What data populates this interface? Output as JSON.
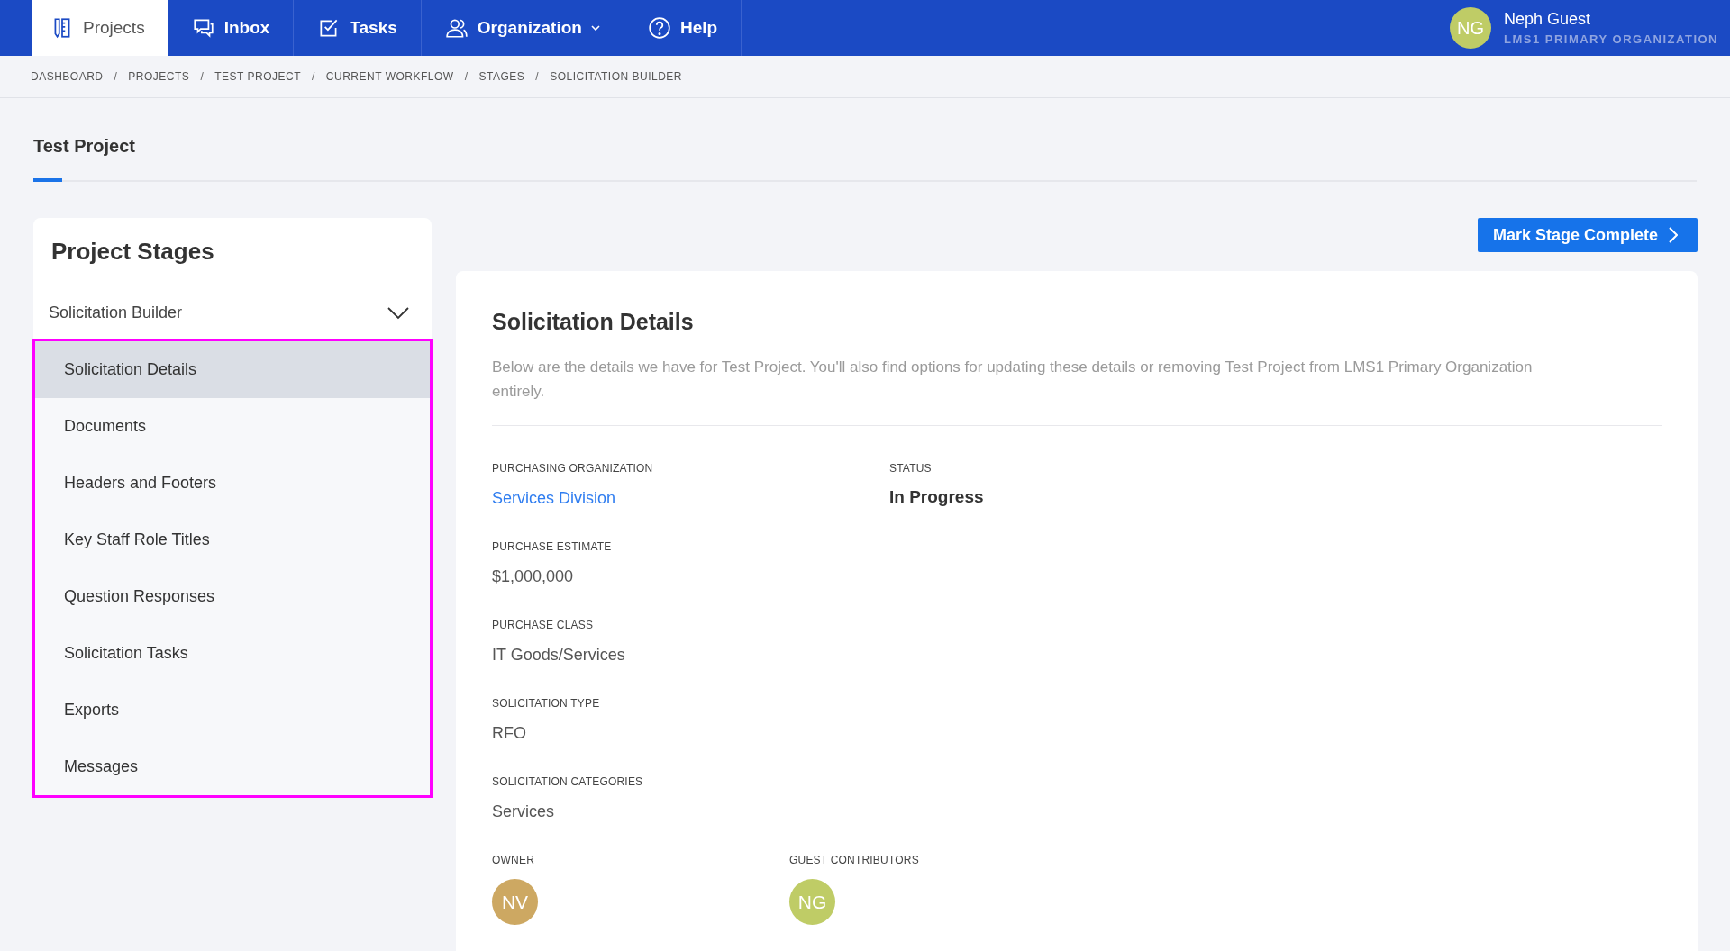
{
  "nav": {
    "tabs": [
      {
        "label": "Projects",
        "selected": true,
        "dropdown": false
      },
      {
        "label": "Inbox",
        "selected": false,
        "dropdown": false
      },
      {
        "label": "Tasks",
        "selected": false,
        "dropdown": false
      },
      {
        "label": "Organization",
        "selected": false,
        "dropdown": true
      },
      {
        "label": "Help",
        "selected": false,
        "dropdown": false
      }
    ],
    "user": {
      "initials": "NG",
      "name": "Neph Guest",
      "organization": "LMS1 PRIMARY ORGANIZATION"
    }
  },
  "breadcrumb": [
    {
      "label": "DASHBOARD"
    },
    {
      "separator": "/",
      "label": "PROJECTS"
    },
    {
      "separator": "/",
      "label": "TEST PROJECT"
    },
    {
      "separator": "/",
      "label": "CURRENT WORKFLOW"
    },
    {
      "separator": "/",
      "label": "STAGES"
    },
    {
      "separator": "/",
      "label": "SOLICITATION BUILDER"
    }
  ],
  "page_tab": {
    "label": "Test Project",
    "selected": true
  },
  "stages": {
    "title": "Project Stages",
    "group": {
      "label": "Solicitation Builder",
      "expanded": true
    },
    "items": [
      {
        "label": "Solicitation Details",
        "selected": true
      },
      {
        "label": "Documents",
        "selected": false
      },
      {
        "label": "Headers and Footers",
        "selected": false
      },
      {
        "label": "Key Staff Role Titles",
        "selected": false
      },
      {
        "label": "Question Responses",
        "selected": false
      },
      {
        "label": "Solicitation Tasks",
        "selected": false
      },
      {
        "label": "Exports",
        "selected": false
      },
      {
        "label": "Messages",
        "selected": false
      }
    ]
  },
  "action_button": "Mark Stage Complete",
  "details": {
    "title": "Solicitation Details",
    "description": "Below are the details we have for Test Project. You'll also find options for updating these details or removing Test Project from LMS1 Primary Organization entirely.",
    "rows": [
      [
        {
          "label": "PURCHASING ORGANIZATION",
          "value": "Services Division",
          "kind": "link"
        },
        {
          "label": "STATUS",
          "value": "In Progress",
          "kind": "strong"
        }
      ],
      [
        {
          "label": "PURCHASE ESTIMATE",
          "value": "$1,000,000",
          "kind": "text"
        }
      ],
      [
        {
          "label": "PURCHASE CLASS",
          "value": "IT Goods/Services",
          "kind": "text"
        }
      ],
      [
        {
          "label": "SOLICITATION TYPE",
          "value": "RFO",
          "kind": "text"
        }
      ],
      [
        {
          "label": "SOLICITATION CATEGORIES",
          "value": "Services",
          "kind": "text"
        }
      ]
    ],
    "people": [
      {
        "label": "OWNER",
        "initials": "NV",
        "color": "#cda862"
      },
      {
        "label": "GUEST CONTRIBUTORS",
        "initials": "NG",
        "color": "#bfcc66"
      }
    ]
  }
}
